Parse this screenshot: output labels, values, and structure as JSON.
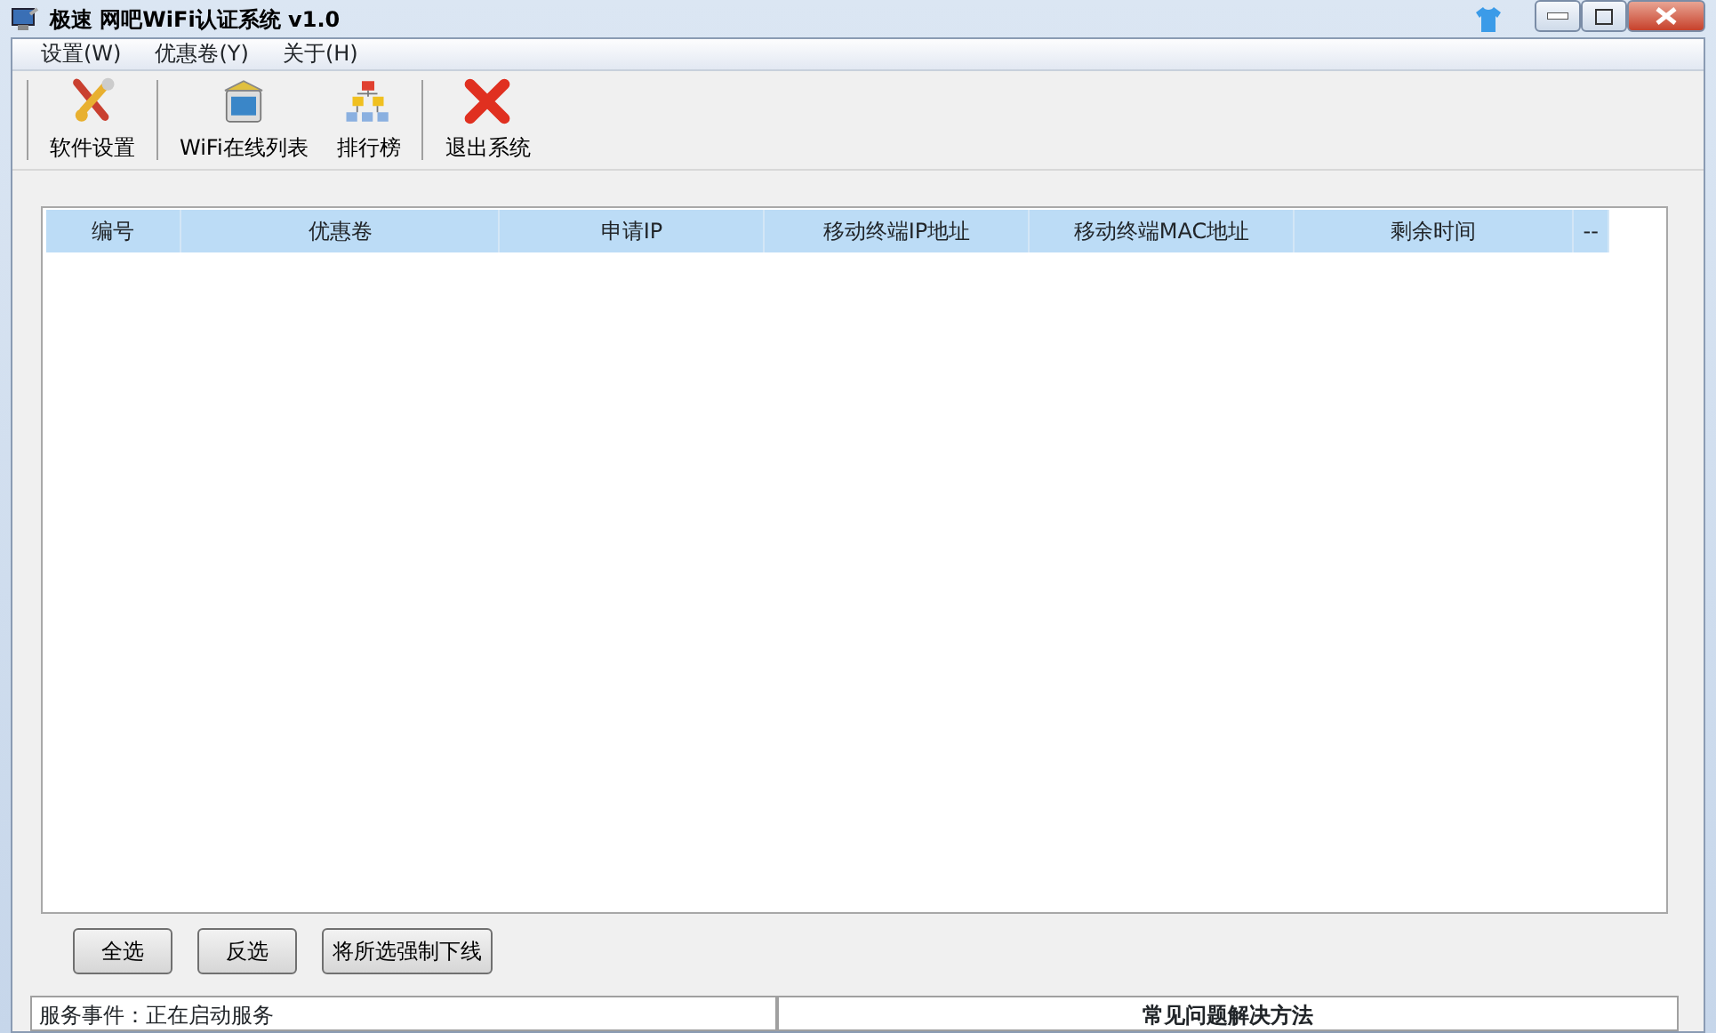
{
  "window": {
    "title": "极速 网吧WiFi认证系统 v1.0"
  },
  "menu": [
    "设置(W)",
    "优惠卷(Y)",
    "关于(H)"
  ],
  "toolbar": [
    {
      "label": "软件设置",
      "kind": "tools"
    },
    {
      "label": "WiFi在线列表",
      "kind": "monitor"
    },
    {
      "label": "排行榜",
      "kind": "hierarchy"
    },
    {
      "label": "退出系统",
      "kind": "exit"
    }
  ],
  "table": {
    "columns": [
      "编号",
      "优惠卷",
      "申请IP",
      "移动终端IP地址",
      "移动终端MAC地址",
      "剩余时间",
      "--"
    ]
  },
  "buttons": [
    "全选",
    "反选",
    "将所选强制下线"
  ],
  "log_panel": {
    "text": "服务事件：正在启动服务"
  },
  "help_panel": {
    "title": "常见问题解决方法"
  }
}
